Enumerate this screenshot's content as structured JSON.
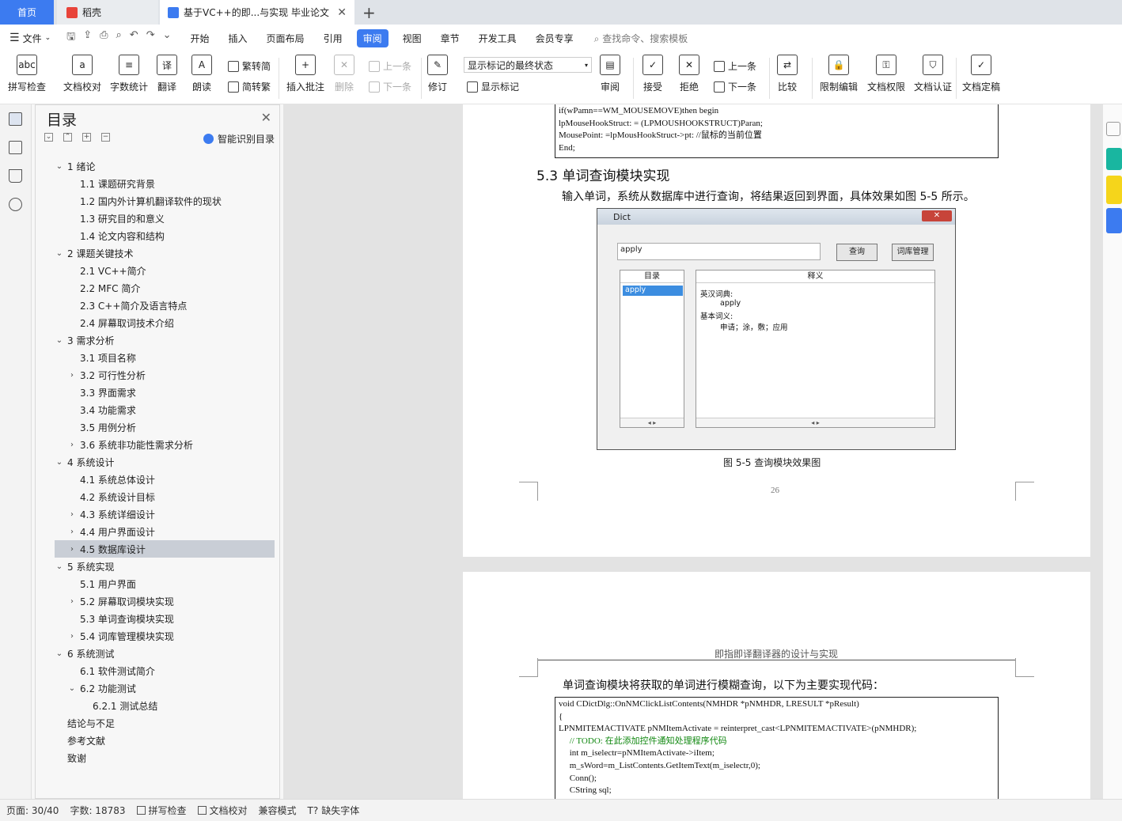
{
  "tabs": {
    "home": "首页",
    "daoke": "稻壳",
    "doc": "基于VC++的即...与实现 毕业论文"
  },
  "menu": {
    "file": "文件",
    "items": [
      "开始",
      "插入",
      "页面布局",
      "引用",
      "审阅",
      "视图",
      "章节",
      "开发工具",
      "会员专享"
    ],
    "active": "审阅",
    "search": "查找命令、搜索模板"
  },
  "ribbon": {
    "spell": "拼写检查",
    "proof": "文档校对",
    "wordcount": "字数统计",
    "translate": "翻译",
    "read": "朗读",
    "trad2simp": "繁转简",
    "simp2trad": "简转繁",
    "insert_comment": "插入批注",
    "delete": "删除",
    "prev": "上一条",
    "next": "下一条",
    "revise": "修订",
    "markup_state": "显示标记的最终状态",
    "show_markup": "显示标记",
    "review": "审阅",
    "accept": "接受",
    "reject": "拒绝",
    "prev2": "上一条",
    "next2": "下一条",
    "compare": "比较",
    "restrict": "限制编辑",
    "doc_rights": "文档权限",
    "doc_cert": "文档认证",
    "doc_final": "文档定稿"
  },
  "toc": {
    "title": "目录",
    "smart": "智能识别目录",
    "items": [
      {
        "label": "1  绪论",
        "level": 1,
        "arrow": "v"
      },
      {
        "label": "1.1  课题研究背景",
        "level": 2,
        "arrow": ""
      },
      {
        "label": "1.2  国内外计算机翻译软件的现状",
        "level": 2,
        "arrow": ""
      },
      {
        "label": "1.3  研究目的和意义",
        "level": 2,
        "arrow": ""
      },
      {
        "label": "1.4  论文内容和结构",
        "level": 2,
        "arrow": ""
      },
      {
        "label": "2  课题关键技术",
        "level": 1,
        "arrow": "v"
      },
      {
        "label": "2.1  VC++简介",
        "level": 2,
        "arrow": ""
      },
      {
        "label": "2.2  MFC 简介",
        "level": 2,
        "arrow": ""
      },
      {
        "label": "2.3  C++简介及语言特点",
        "level": 2,
        "arrow": ""
      },
      {
        "label": "2.4  屏幕取词技术介绍",
        "level": 2,
        "arrow": ""
      },
      {
        "label": "3  需求分析",
        "level": 1,
        "arrow": "v"
      },
      {
        "label": "3.1  项目名称",
        "level": 2,
        "arrow": ""
      },
      {
        "label": "3.2  可行性分析",
        "level": 2,
        "arrow": ">"
      },
      {
        "label": "3.3  界面需求",
        "level": 2,
        "arrow": ""
      },
      {
        "label": "3.4  功能需求",
        "level": 2,
        "arrow": ""
      },
      {
        "label": "3.5  用例分析",
        "level": 2,
        "arrow": ""
      },
      {
        "label": "3.6  系统非功能性需求分析",
        "level": 2,
        "arrow": ">"
      },
      {
        "label": "4  系统设计",
        "level": 1,
        "arrow": "v"
      },
      {
        "label": "4.1  系统总体设计",
        "level": 2,
        "arrow": ""
      },
      {
        "label": "4.2  系统设计目标",
        "level": 2,
        "arrow": ""
      },
      {
        "label": "4.3  系统详细设计",
        "level": 2,
        "arrow": ">"
      },
      {
        "label": "4.4  用户界面设计",
        "level": 2,
        "arrow": ">"
      },
      {
        "label": "4.5  数据库设计",
        "level": 2,
        "arrow": ">",
        "selected": true
      },
      {
        "label": "5  系统实现",
        "level": 1,
        "arrow": "v"
      },
      {
        "label": "5.1  用户界面",
        "level": 2,
        "arrow": ""
      },
      {
        "label": "5.2  屏幕取词模块实现",
        "level": 2,
        "arrow": ">"
      },
      {
        "label": "5.3  单词查询模块实现",
        "level": 2,
        "arrow": ""
      },
      {
        "label": "5.4  词库管理模块实现",
        "level": 2,
        "arrow": ">"
      },
      {
        "label": "6  系统测试",
        "level": 1,
        "arrow": "v"
      },
      {
        "label": "6.1  软件测试简介",
        "level": 2,
        "arrow": ""
      },
      {
        "label": "6.2  功能测试",
        "level": 2,
        "arrow": "v"
      },
      {
        "label": "6.2.1  测试总结",
        "level": 3,
        "arrow": ""
      },
      {
        "label": "结论与不足",
        "level": 1,
        "arrow": ""
      },
      {
        "label": "参考文献",
        "level": 1,
        "arrow": ""
      },
      {
        "label": "致谢",
        "level": 1,
        "arrow": ""
      }
    ]
  },
  "doc": {
    "code1": [
      "if(wPamn==WM_MOUSEMOVE)then begin",
      "lpMouseHookStruct: = (LPMOUSHOOKSTRUCT)Paran;",
      "MousePoint: =lpMousHookStruct->pt: //鼠标的当前位置",
      "End;"
    ],
    "heading": "5.3   单词查询模块实现",
    "para1": "输入单词，系统从数据库中进行查询，将结果返回到界面，具体效果如图 5-5 所示。",
    "dict": {
      "title": "Dict",
      "input": "apply",
      "query_btn": "查询",
      "lib_btn": "词库管理",
      "list_header": "目录",
      "list_item": "apply",
      "def_header": "释义",
      "line1": "英汉词典:",
      "line2": "apply",
      "line3": "基本词义:",
      "line4": "申请；涂，敷；应用"
    },
    "caption": "图 5-5 查询模块效果图",
    "page_number": "26",
    "header2": "即指即译翻译器的设计与实现",
    "para2": "单词查询模块将获取的单词进行模糊查询，以下为主要实现代码：",
    "code2": [
      "void CDictDlg::OnNMClickListContents(NMHDR *pNMHDR, LRESULT *pResult)",
      "{",
      "LPNMITEMACTIVATE pNMItemActivate = reinterpret_cast<LPNMITEMACTIVATE>(pNMHDR);",
      "     // TODO: 在此添加控件通知处理程序代码",
      "     int m_iselectr=pNMItemActivate->iItem;",
      "     m_sWord=m_ListContents.GetItemText(m_iselectr,0);",
      "     Conn();",
      "     CString sql;"
    ]
  },
  "status": {
    "page": "页面: 30/40",
    "words": "字数: 18783",
    "spell": "拼写检查",
    "proof": "文档校对",
    "compat": "兼容模式",
    "missing_font": "缺失字体"
  }
}
